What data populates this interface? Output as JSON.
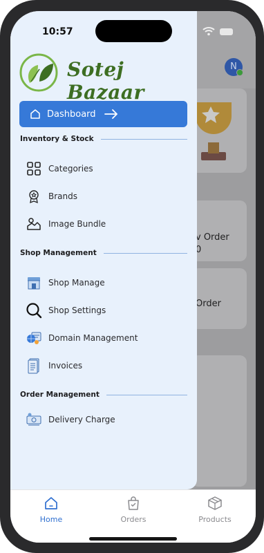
{
  "status_bar": {
    "time": "10:57"
  },
  "brand": {
    "name": "Sotej Bazaar"
  },
  "drawer": {
    "dashboard_label": "Dashboard",
    "sections": [
      {
        "title": "Inventory & Stock",
        "items": [
          "Categories",
          "Brands",
          "Image Bundle"
        ]
      },
      {
        "title": "Shop Management",
        "items": [
          "Shop Manage",
          "Shop Settings",
          "Domain Management",
          "Invoices"
        ]
      },
      {
        "title": "Order Management",
        "items": [
          "Delivery Charge"
        ]
      }
    ]
  },
  "background": {
    "avatar_initial": "N",
    "card_text_1": "v Order",
    "card_text_2": "0",
    "card_text_3": "Order"
  },
  "tabbar": {
    "tabs": [
      {
        "label": "Home",
        "active": true
      },
      {
        "label": "Orders",
        "active": false
      },
      {
        "label": "Products",
        "active": false
      }
    ]
  },
  "colors": {
    "accent": "#3679d8",
    "brand_green": "#3d6e22",
    "drawer_bg": "#e8f1fc"
  }
}
